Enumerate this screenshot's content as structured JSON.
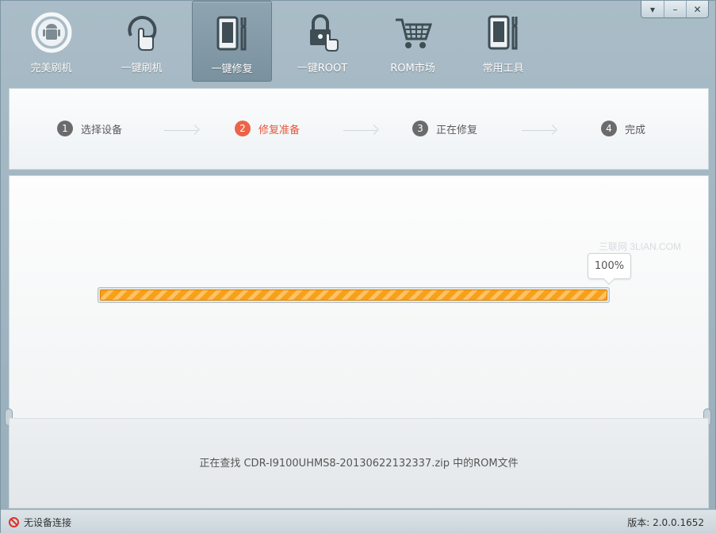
{
  "window_controls": {
    "menu": "▾",
    "minimize": "–",
    "close": "✕"
  },
  "toolbar": {
    "items": [
      {
        "label": "完美刷机",
        "icon": "android-refresh-icon",
        "active": false
      },
      {
        "label": "一键刷机",
        "icon": "hand-refresh-icon",
        "active": false
      },
      {
        "label": "一键修复",
        "icon": "phone-wrench-icon",
        "active": true
      },
      {
        "label": "一键ROOT",
        "icon": "lock-hand-icon",
        "active": false
      },
      {
        "label": "ROM市场",
        "icon": "shopping-cart-icon",
        "active": false
      },
      {
        "label": "常用工具",
        "icon": "phone-tools-icon",
        "active": false
      }
    ]
  },
  "steps": [
    {
      "num": "1",
      "label": "选择设备",
      "active": false
    },
    {
      "num": "2",
      "label": "修复准备",
      "active": true
    },
    {
      "num": "3",
      "label": "正在修复",
      "active": false
    },
    {
      "num": "4",
      "label": "完成",
      "active": false
    }
  ],
  "watermark": "三联网 3LIAN.COM",
  "progress": {
    "percent_label": "100%",
    "value": 1.0
  },
  "status_text": "正在查找 CDR-I9100UHMS8-20130622132337.zip 中的ROM文件",
  "footer": {
    "device_status": "无设备连接",
    "version": "版本: 2.0.0.1652"
  },
  "colors": {
    "accent": "#ec6447",
    "progress": "#f7a11a",
    "toolbar_bg": "#a3b7c2"
  }
}
